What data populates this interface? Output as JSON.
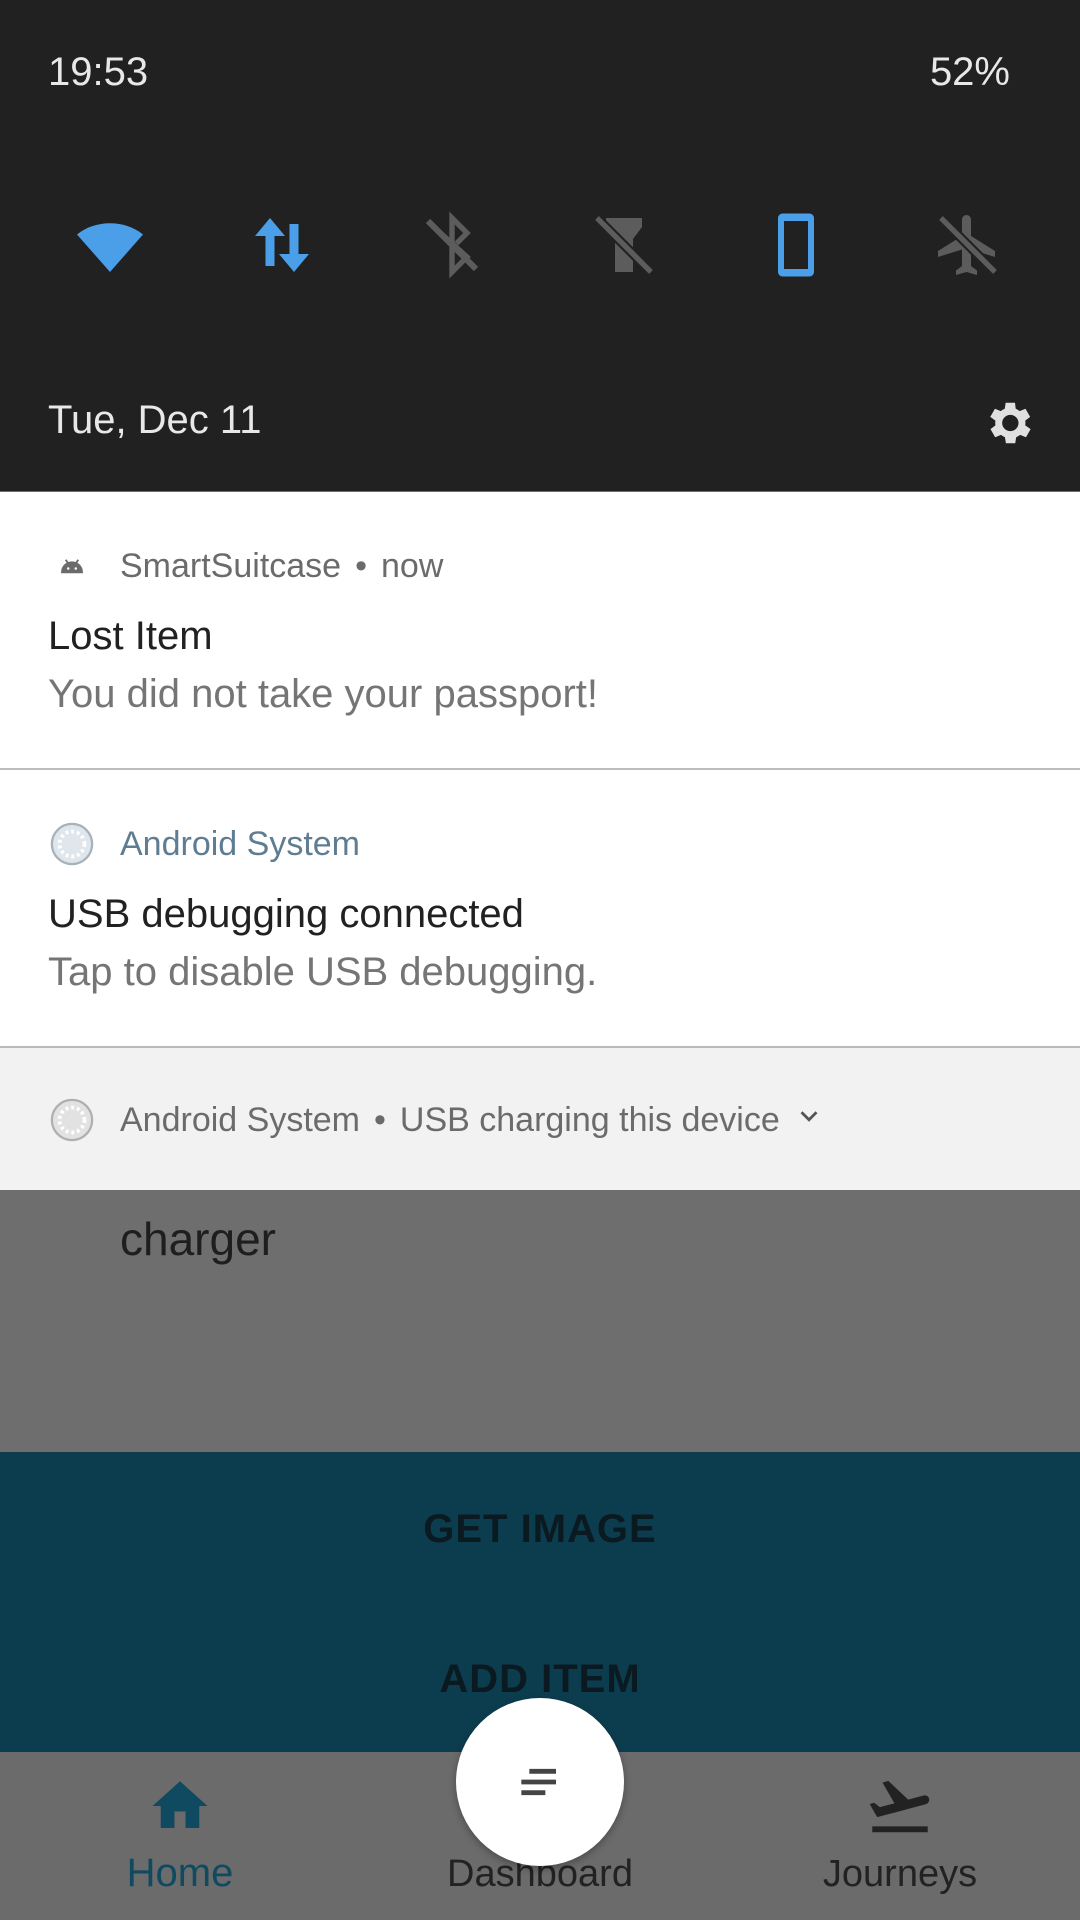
{
  "status_bar": {
    "time": "19:53",
    "battery": "52%"
  },
  "quick_settings": {
    "tiles": [
      {
        "name": "wifi",
        "icon": "wifi-icon",
        "state": "on"
      },
      {
        "name": "mobile-data",
        "icon": "data-arrows-icon",
        "state": "on"
      },
      {
        "name": "bluetooth",
        "icon": "bluetooth-off-icon",
        "state": "off"
      },
      {
        "name": "flashlight",
        "icon": "flashlight-off-icon",
        "state": "off"
      },
      {
        "name": "auto-rotate",
        "icon": "phone-portrait-icon",
        "state": "on"
      },
      {
        "name": "airplane-mode",
        "icon": "airplane-off-icon",
        "state": "off"
      }
    ],
    "date": "Tue, Dec 11",
    "accent": "#4a90e2"
  },
  "notifications": [
    {
      "app": "SmartSuitcase",
      "time": "now",
      "title": "Lost Item",
      "text": "You did not take your passport!"
    },
    {
      "app": "Android System",
      "title": "USB debugging connected",
      "text": "Tap to disable USB debugging."
    },
    {
      "app": "Android System",
      "summary": "USB charging this device"
    }
  ],
  "app": {
    "list_item": "charger",
    "get_image_label": "GET IMAGE",
    "add_item_label": "ADD ITEM",
    "nav": {
      "home": "Home",
      "dashboard": "Dashboard",
      "journeys": "Journeys"
    },
    "colors": {
      "action_bar": "#0c3d4f",
      "nav_active": "#0f4a60"
    }
  }
}
